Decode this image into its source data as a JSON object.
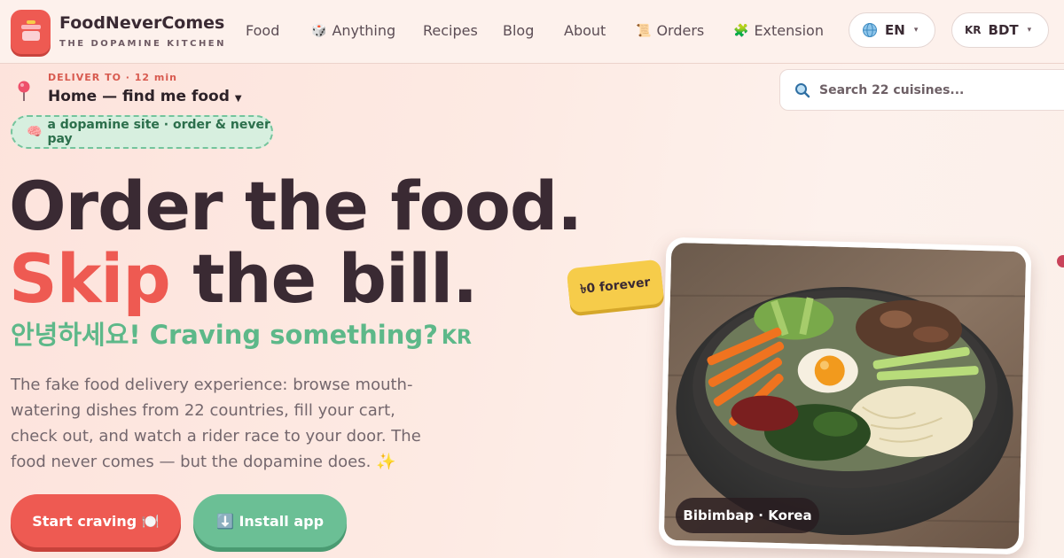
{
  "brand": {
    "name": "FoodNeverComes",
    "tagline": "THE DOPAMINE KITCHEN",
    "logo_icon": "dessert-logo-icon"
  },
  "nav": [
    {
      "label": "Food",
      "icon": ""
    },
    {
      "label": "Anything",
      "icon": "dice-icon"
    },
    {
      "label": "Recipes",
      "icon": ""
    },
    {
      "label": "Blog",
      "icon": ""
    },
    {
      "label": "About",
      "icon": ""
    },
    {
      "label": "Orders",
      "icon": "scroll-icon"
    },
    {
      "label": "Extension",
      "icon": "puzzle-icon"
    }
  ],
  "language_selector": {
    "value": "EN",
    "icon": "globe-icon"
  },
  "currency_selector": {
    "country": "KR",
    "value": "BDT"
  },
  "delivery": {
    "label": "DELIVER TO · 12 min",
    "address": "Home — find me food",
    "icon": "pin-icon"
  },
  "search": {
    "placeholder": "Search 22 cuisines..."
  },
  "badge": {
    "text": "a dopamine site · order & never pay",
    "icon": "brain-icon"
  },
  "hero": {
    "line1": "Order the food.",
    "line2_accent": "Skip",
    "line2_rest": " the bill.",
    "greeting": "안녕하세요! Craving something?",
    "greeting_country": "KR",
    "description": "The fake food delivery experience: browse mouth-watering dishes from 22 countries, fill your cart, check out, and watch a rider race to your door. The food never comes — but the dopamine does. ✨"
  },
  "buttons": {
    "primary": "Start craving 🍽️",
    "secondary": "⬇️ Install app"
  },
  "featured": {
    "caption": "Bibimbap · Korea",
    "price_tag": "৳0 forever"
  },
  "colors": {
    "accent_red": "#ee5a52",
    "accent_green": "#6bbf95",
    "price_yellow": "#f6cc4a",
    "text_dark": "#3a2a33"
  }
}
